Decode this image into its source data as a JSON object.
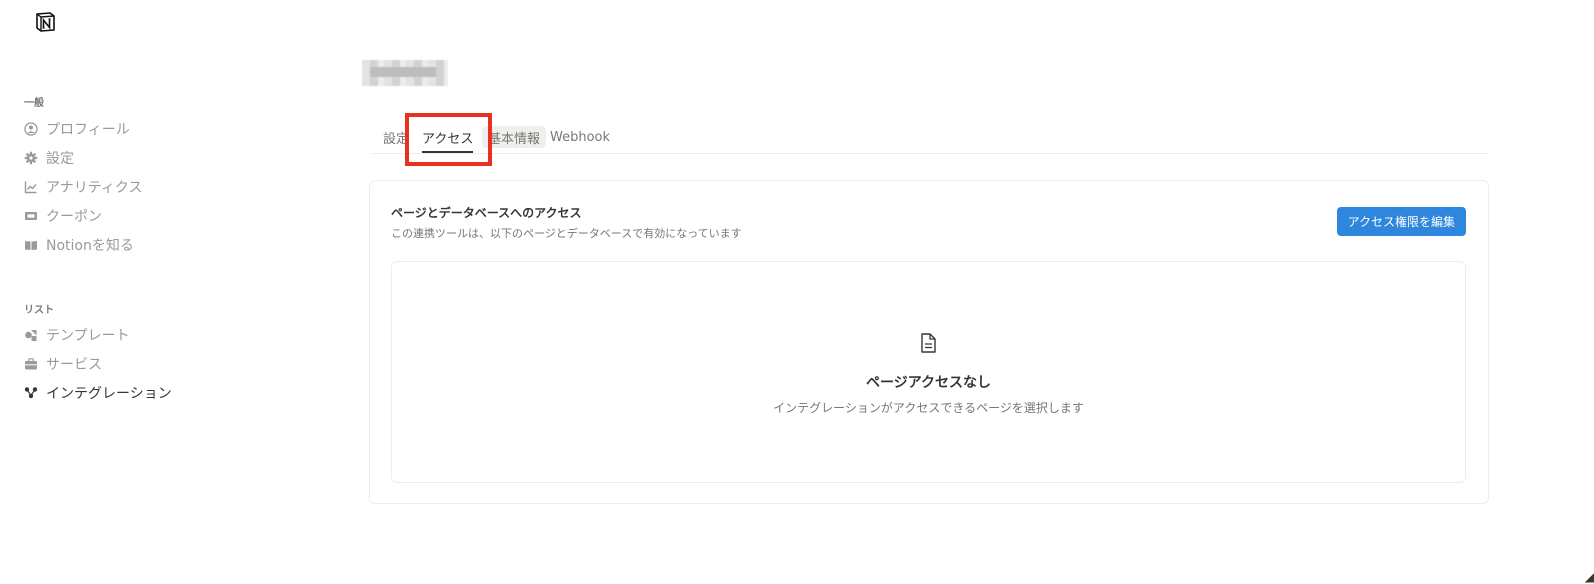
{
  "sidebar": {
    "sections": [
      {
        "label": "一般",
        "items": [
          {
            "label": "プロフィール",
            "icon": "user-circle-icon"
          },
          {
            "label": "設定",
            "icon": "gear-icon"
          },
          {
            "label": "アナリティクス",
            "icon": "chart-icon"
          },
          {
            "label": "クーポン",
            "icon": "ticket-icon"
          },
          {
            "label": "Notionを知る",
            "icon": "book-icon"
          }
        ]
      },
      {
        "label": "リスト",
        "items": [
          {
            "label": "テンプレート",
            "icon": "shapes-icon"
          },
          {
            "label": "サービス",
            "icon": "briefcase-icon"
          },
          {
            "label": "インテグレーション",
            "icon": "integration-icon",
            "active": true
          }
        ]
      }
    ]
  },
  "tabs": [
    {
      "label": "設定"
    },
    {
      "label": "アクセス",
      "active": true
    },
    {
      "label": "基本情報"
    },
    {
      "label": "Webhook"
    }
  ],
  "access": {
    "title": "ページとデータベースへのアクセス",
    "subtitle": "この連携ツールは、以下のページとデータベースで有効になっています",
    "edit_button": "アクセス権限を編集",
    "empty_title": "ページアクセスなし",
    "empty_description": "インテグレーションがアクセスできるページを選択します"
  },
  "colors": {
    "accent": "#2f86dd",
    "highlight": "#e8321f"
  }
}
